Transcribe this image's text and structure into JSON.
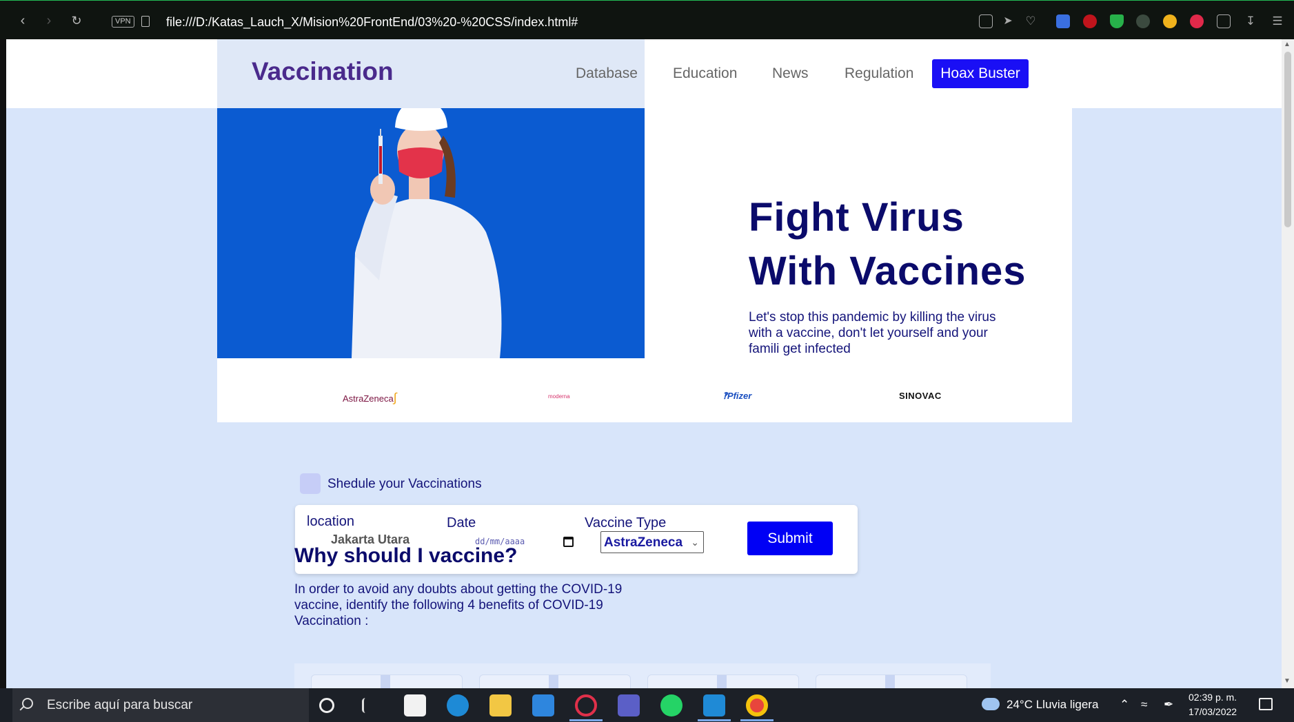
{
  "browser": {
    "url": "file:///D:/Katas_Lauch_X/Mision%20FrontEnd/03%20-%20CSS/index.html#",
    "vpn_label": "VPN"
  },
  "header": {
    "brand": "Vaccination",
    "nav": [
      "Database",
      "Education",
      "News",
      "Regulation"
    ],
    "cta": "Hoax Buster"
  },
  "hero": {
    "title_line1": "Fight Virus",
    "title_line2": "With Vaccines",
    "text": "Let's stop this pandemic by killing the virus with a vaccine, don't let yourself and your famili get infected"
  },
  "partners": [
    "AstraZeneca",
    "moderna",
    "Pfizer",
    "SINOVAC"
  ],
  "schedule": {
    "label": "Shedule your Vaccinations",
    "location_label": "location",
    "location_value": "Jakarta Utara",
    "date_label": "Date",
    "date_placeholder": "dd/mm/aaaa",
    "vaccine_label": "Vaccine Type",
    "vaccine_value": "AstraZeneca",
    "submit": "Submit"
  },
  "why": {
    "title": "Why should I vaccine?",
    "text": "In order to avoid any doubts about getting the COVID-19 vaccine, identify the following 4 benefits of COVID-19 Vaccination :"
  },
  "taskbar": {
    "search_placeholder": "Escribe aquí para buscar",
    "weather": "24°C  Lluvia ligera",
    "time": "02:39 p. m.",
    "date": "17/03/2022"
  },
  "colors": {
    "brand": "#4a2a8c",
    "primary_button": "#1a0ff5",
    "heading": "#0b0b6b",
    "page_bg": "#d8e5fa"
  }
}
